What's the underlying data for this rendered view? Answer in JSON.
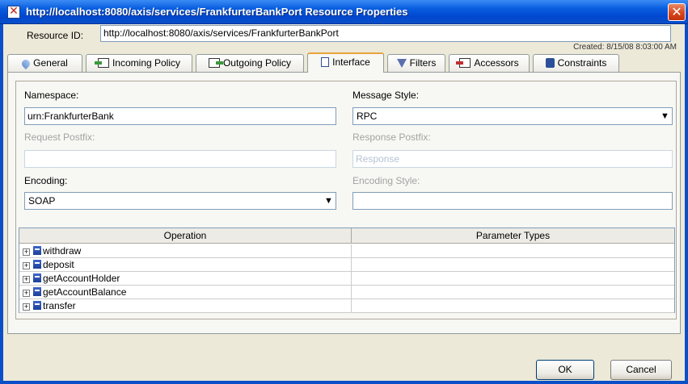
{
  "window": {
    "title": "http://localhost:8080/axis/services/FrankfurterBankPort Resource Properties",
    "app_icon": "app-logo-icon",
    "close_glyph": "✕"
  },
  "header": {
    "resource_id_label": "Resource ID:",
    "resource_id_value": "http://localhost:8080/axis/services/FrankfurterBankPort",
    "created": "Created: 8/15/08 8:03:00 AM"
  },
  "tabs": [
    {
      "label": "General",
      "icon": "general-icon",
      "active": false
    },
    {
      "label": "Incoming Policy",
      "icon": "incoming-policy-icon",
      "active": false
    },
    {
      "label": "Outgoing Policy",
      "icon": "outgoing-policy-icon",
      "active": false
    },
    {
      "label": "Interface",
      "icon": "interface-icon",
      "active": true
    },
    {
      "label": "Filters",
      "icon": "filter-icon",
      "active": false
    },
    {
      "label": "Accessors",
      "icon": "accessors-icon",
      "active": false
    },
    {
      "label": "Constraints",
      "icon": "constraints-icon",
      "active": false
    }
  ],
  "form": {
    "namespace_label": "Namespace:",
    "namespace_value": "urn:FrankfurterBank",
    "message_style_label": "Message Style:",
    "message_style_value": "RPC",
    "request_postfix_label": "Request Postfix:",
    "request_postfix_value": "",
    "response_postfix_label": "Response Postfix:",
    "response_postfix_placeholder": "Response",
    "encoding_label": "Encoding:",
    "encoding_value": "SOAP",
    "encoding_style_label": "Encoding Style:",
    "encoding_style_value": ""
  },
  "table": {
    "columns": [
      "Operation",
      "Parameter Types"
    ],
    "rows": [
      {
        "operation": "withdraw",
        "params": ""
      },
      {
        "operation": "deposit",
        "params": ""
      },
      {
        "operation": "getAccountHolder",
        "params": ""
      },
      {
        "operation": "getAccountBalance",
        "params": ""
      },
      {
        "operation": "transfer",
        "params": ""
      }
    ],
    "expand_glyph": "+"
  },
  "buttons": {
    "ok": "OK",
    "cancel": "Cancel"
  },
  "colors": {
    "titlebar": "#0a5fe0",
    "dialog_bg": "#ece9d8",
    "active_tab_accent": "#e8a33a"
  }
}
